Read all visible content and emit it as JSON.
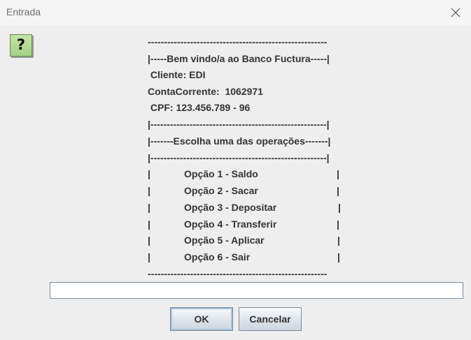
{
  "window": {
    "title": "Entrada"
  },
  "icons": {
    "question": "?",
    "close": "close-icon"
  },
  "message": {
    "rule_top": "-------------------------------------------------------",
    "welcome": "|-----Bem vindo/a ao Banco Fuctura-----|",
    "cliente": " Cliente: EDI",
    "conta": "ContaCorrente:  1062971",
    "cpf": " CPF: 123.456.789 - 96",
    "rule_mid": "|------------------------------------------------------|",
    "escolha": "|-------Escolha uma das operações-------|",
    "rule_mid2": "|------------------------------------------------------|",
    "options": [
      "Opção 1 - Saldo",
      "Opção 2 - Sacar",
      "Opção 3 - Depositar",
      "Opção 4 - Transferir",
      "Opção 5 - Aplicar",
      "Opção 6 - Sair"
    ],
    "option_bar": "|",
    "rule_bottom": "-------------------------------------------------------"
  },
  "input": {
    "value": "",
    "placeholder": ""
  },
  "buttons": {
    "ok": "OK",
    "cancel": "Cancelar"
  }
}
